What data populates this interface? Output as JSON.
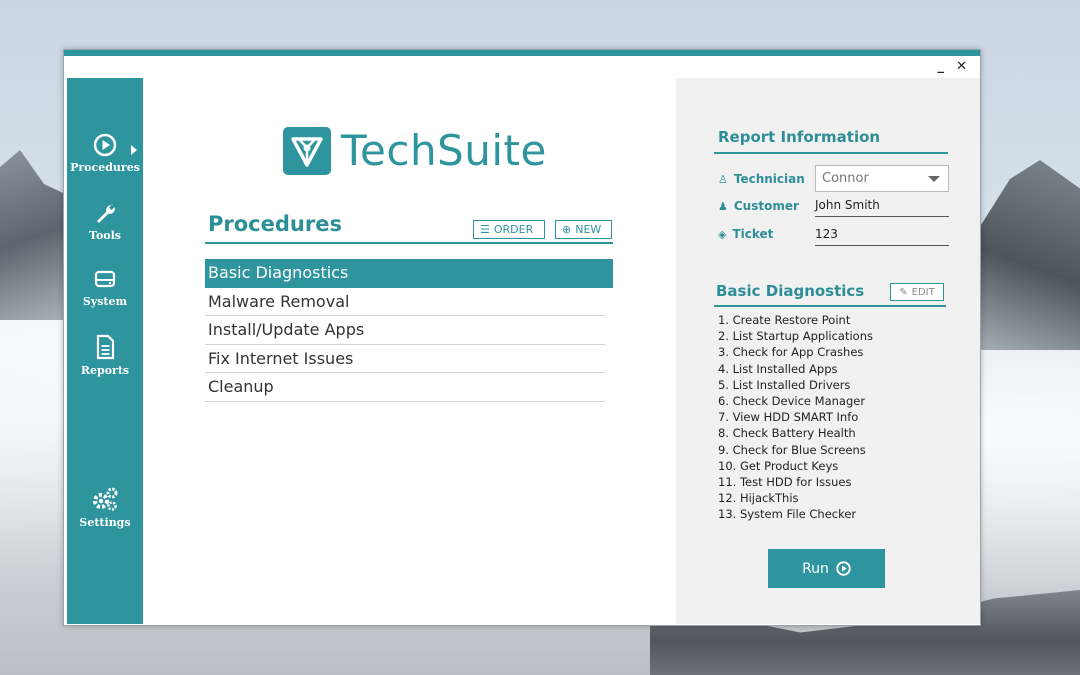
{
  "window": {
    "minimize": "_",
    "close": "✕"
  },
  "sidebar": {
    "items": [
      {
        "label": "Procedures",
        "icon": "play-circle-icon"
      },
      {
        "label": "Tools",
        "icon": "wrench-icon"
      },
      {
        "label": "System",
        "icon": "hard-drive-icon"
      },
      {
        "label": "Reports",
        "icon": "document-icon"
      },
      {
        "label": "Settings",
        "icon": "gears-icon"
      }
    ]
  },
  "brand": {
    "name": "TechSuite"
  },
  "procedures": {
    "title": "Procedures",
    "order_label": "ORDER",
    "new_label": "NEW",
    "items": [
      "Basic Diagnostics",
      "Malware Removal",
      "Install/Update Apps",
      "Fix Internet Issues",
      "Cleanup"
    ],
    "selected_index": 0
  },
  "report": {
    "title": "Report Information",
    "technician_label": "Technician",
    "technician_value": "Connor",
    "customer_label": "Customer",
    "customer_value": "John Smith",
    "ticket_label": "Ticket",
    "ticket_value": "123"
  },
  "details": {
    "title": "Basic Diagnostics",
    "edit_label": "EDIT",
    "steps": [
      "1. Create Restore Point",
      "2. List Startup Applications",
      "3. Check for App Crashes",
      "4. List Installed Apps",
      "5. List Installed Drivers",
      "6. Check Device Manager",
      "7. View HDD SMART Info",
      "8. Check Battery Health",
      "9. Check for Blue Screens",
      "10. Get Product Keys",
      "11. Test HDD for Issues",
      "12. HijackThis",
      "13. System File Checker"
    ],
    "run_label": "Run"
  },
  "colors": {
    "accent": "#2e949e",
    "panel": "#f1f1f1"
  }
}
